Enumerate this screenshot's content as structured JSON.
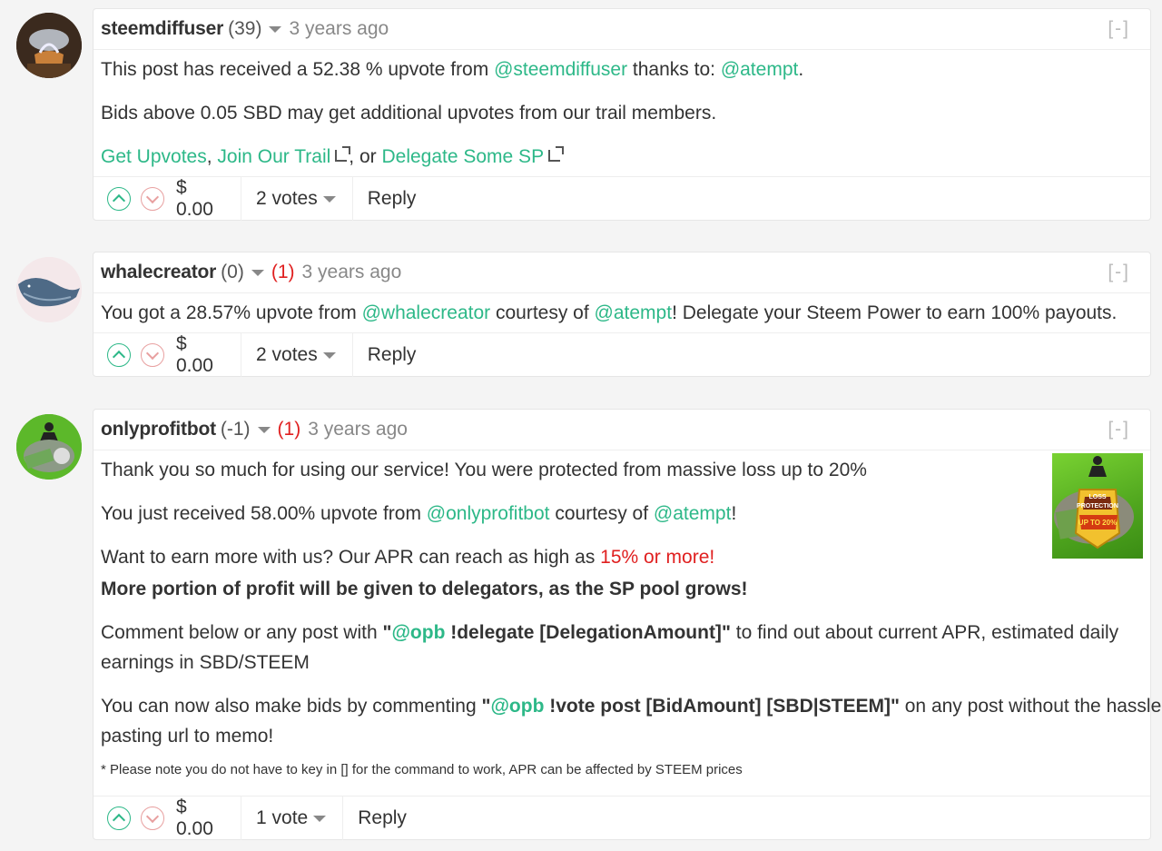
{
  "comments": [
    {
      "author": "steemdiffuser",
      "rep": "(39)",
      "flag": "",
      "time": "3 years ago",
      "collapse": "[-]",
      "lines": {
        "l1": {
          "a": "This post has received a 52.38 % upvote from ",
          "b": "@steemdiffuser",
          "c": " thanks to: ",
          "d": "@atempt",
          "e": "."
        },
        "l2": "Bids above 0.05 SBD may get additional upvotes from our trail members.",
        "l3": {
          "a": "Get Upvotes",
          "b": ", ",
          "c": "Join Our Trail",
          "d": ", or ",
          "e": "Delegate Some SP"
        }
      },
      "payout": "$ 0.00",
      "votes": "2 votes",
      "reply": "Reply"
    },
    {
      "author": "whalecreator",
      "rep": "(0)",
      "flag": "(1)",
      "time": "3 years ago",
      "collapse": "[-]",
      "lines": {
        "l1": {
          "a": "You got a 28.57% upvote from ",
          "b": "@whalecreator",
          "c": " courtesy of ",
          "d": "@atempt",
          "e": "! Delegate your Steem Power to earn 100% payouts."
        }
      },
      "payout": "$ 0.00",
      "votes": "2 votes",
      "reply": "Reply"
    },
    {
      "author": "onlyprofitbot",
      "rep": "(-1)",
      "flag": "(1)",
      "time": "3 years ago",
      "collapse": "[-]",
      "thumb_text": {
        "t1": "LOSS",
        "t2": "PROTECTION",
        "t3": "UP TO 20%"
      },
      "lines": {
        "l1": "Thank you so much for using our service! You were protected from massive loss up to 20%",
        "l2": {
          "a": "You just received 58.00% upvote from ",
          "b": "@onlyprofitbot",
          "c": " courtesy of ",
          "d": "@atempt",
          "e": "!"
        },
        "l3": {
          "a": "Want to earn more with us? Our APR can reach as high as ",
          "b": "15% or more!"
        },
        "l4": "More portion of profit will be given to delegators, as the SP pool grows!",
        "l5": {
          "a": "Comment below or any post with ",
          "b": "\"",
          "c": "@opb",
          "d": " !delegate ",
          "e": "[DelegationAmount]",
          "f": "\"",
          "g": " to find out about current APR, estimated daily"
        },
        "l5b": "earnings in SBD/STEEM",
        "l6": {
          "a": "You can now also make bids by commenting ",
          "b": "\"",
          "c": "@opb",
          "d": " !vote post ",
          "e": "[BidAmount]",
          "f": " [",
          "g": "SBD",
          "h": "|",
          "i": "STEEM",
          "j": "]\"",
          "k": " on any post without the hassle of"
        },
        "l6b": "pasting url to memo!",
        "l7": "* Please note you do not have to key in [] for the command to work, APR can be affected by STEEM prices"
      },
      "payout": "$ 0.00",
      "votes": "1 vote",
      "reply": "Reply"
    }
  ],
  "icons": {
    "upvote": "chevron-up-icon",
    "downvote": "chevron-down-icon",
    "external": "external-link-icon"
  },
  "colors": {
    "link": "#2db888",
    "flag": "#e02020",
    "muted": "#888888"
  }
}
